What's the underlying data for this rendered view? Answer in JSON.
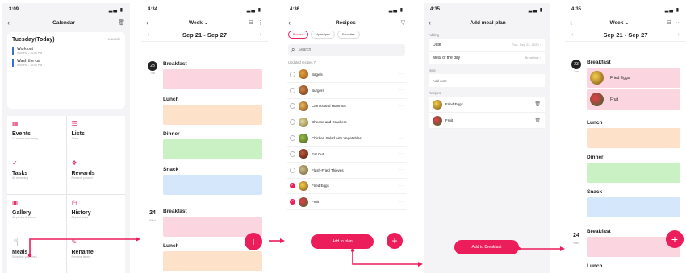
{
  "colors": {
    "accent": "#ec1d5b",
    "event_bar": "#3a6fd8"
  },
  "screen1": {
    "time": "3:09",
    "title": "Calendar",
    "today_title": "Tuesday(Today)",
    "today_link": "Launch",
    "events": [
      {
        "name": "Work out",
        "sub": "9:00 PM - 10:00 PM"
      },
      {
        "name": "Wash the car",
        "sub": "9:00 PM - 10:00 PM"
      }
    ],
    "tiles": [
      {
        "name": "Events",
        "sub": "13 events remaining",
        "icon": "calendar-icon"
      },
      {
        "name": "Lists",
        "sub": "1 lists",
        "icon": "list-icon"
      },
      {
        "name": "Tasks",
        "sub": "All remaining",
        "icon": "check-icon"
      },
      {
        "name": "Rewards",
        "sub": "Rewards passed",
        "icon": "gift-icon"
      },
      {
        "name": "Gallery",
        "sub": "All photos & videos",
        "icon": "image-icon"
      },
      {
        "name": "History",
        "sub": "All past tasks",
        "icon": "clock-icon"
      },
      {
        "name": "Meals",
        "sub": "Schedule your meal",
        "icon": "utensils-icon"
      },
      {
        "name": "Rename",
        "sub": "Rename labels",
        "icon": "edit-icon"
      }
    ]
  },
  "screen2": {
    "time": "4:34",
    "view": "Week",
    "range": "Sep 21 - Sep 27",
    "day1": {
      "num": "23",
      "wd": "Tue"
    },
    "day2": {
      "num": "24",
      "wd": "Wed"
    },
    "meals": [
      "Breakfast",
      "Lunch",
      "Dinner",
      "Snack"
    ],
    "fab": "+"
  },
  "screen3": {
    "time": "4:36",
    "title": "Recipes",
    "segments": [
      "Browse",
      "My recipes",
      "Favorites"
    ],
    "search_placeholder": "Search",
    "section": "Updated recipes 7",
    "recipes": [
      {
        "name": "Bagels",
        "checked": false
      },
      {
        "name": "Burgers",
        "checked": false
      },
      {
        "name": "Carrots and Hummus",
        "checked": false
      },
      {
        "name": "Cheese and Crackers",
        "checked": false
      },
      {
        "name": "Chicken Salad with Vegetables",
        "checked": false
      },
      {
        "name": "Eat Out",
        "checked": false
      },
      {
        "name": "Flash-Fried Thieves",
        "checked": false
      },
      {
        "name": "Fried Eggs",
        "checked": true
      },
      {
        "name": "Fruit",
        "checked": true
      }
    ],
    "add_button": "Add to plan",
    "fab": "+"
  },
  "screen4": {
    "time": "4:35",
    "title": "Add meal plan",
    "group_label": "Adding",
    "date_label": "Date",
    "date_value": "Tue, Sep 23, 2025",
    "meal_label": "Meal of the day",
    "meal_value": "Breakfast",
    "note_label": "Note",
    "note_placeholder": "Add note",
    "recipes_label": "Recipes",
    "selected": [
      "Fried Eggs",
      "Fruit"
    ],
    "add_button": "Add to Breakfast"
  },
  "screen5": {
    "time": "4:35",
    "view": "Week",
    "range": "Sep 21 - Sep 27",
    "day1": {
      "num": "23",
      "wd": "Tue"
    },
    "day2": {
      "num": "24",
      "wd": "Wed"
    },
    "breakfast": "Breakfast",
    "items": [
      "Fried Eggs",
      "Fruit"
    ],
    "meals": [
      "Lunch",
      "Dinner",
      "Snack"
    ],
    "breakfast2": "Breakfast",
    "lunch2": "Lunch",
    "fab": "+"
  }
}
